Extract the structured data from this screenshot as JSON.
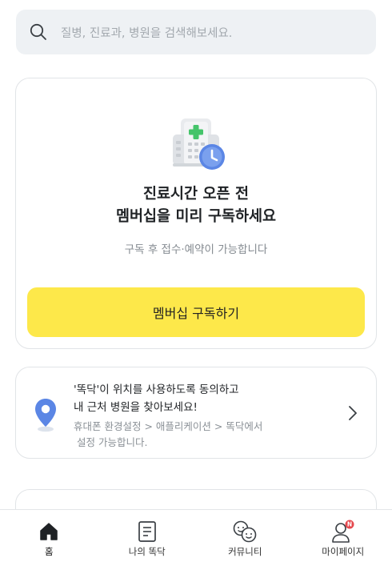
{
  "search": {
    "placeholder": "질병, 진료과, 병원을 검색해보세요.",
    "icon": "search-icon"
  },
  "membership": {
    "title_line1": "진료시간 오픈 전",
    "title_line2": "멤버십을 미리 구독하세요",
    "subtitle": "구독 후 접수·예약이 가능합니다",
    "button_label": "멤버십 구독하기",
    "button_color": "#fde84a",
    "illustration": "hospital-clock-icon"
  },
  "location": {
    "line1": "'똑닥'이 위치를 사용하도록 동의하고",
    "line2": "내 근처 병원을 찾아보세요!",
    "sub1": "휴대폰 환경설정 > 애플리케이션 > 똑닥에서",
    "sub2": "설정 가능합니다.",
    "icon": "location-pin-icon"
  },
  "tabs": [
    {
      "label": "홈",
      "icon": "home-icon",
      "active": true
    },
    {
      "label": "나의 똑닥",
      "icon": "document-icon",
      "active": false
    },
    {
      "label": "커뮤니티",
      "icon": "community-icon",
      "active": false
    },
    {
      "label": "마이페이지",
      "icon": "profile-icon",
      "active": false,
      "badge": "N"
    }
  ],
  "colors": {
    "accent": "#fde84a",
    "pin": "#5b86e5",
    "badge": "#e5484d"
  }
}
